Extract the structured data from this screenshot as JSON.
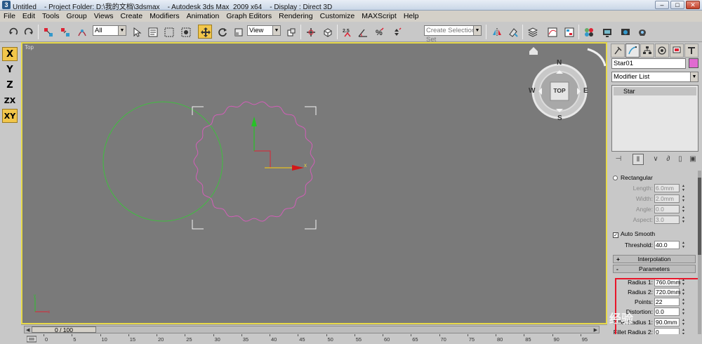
{
  "window": {
    "title": "Untitled    - Project Folder: D:\\我的文档\\3dsmax    - Autodesk 3ds Max  2009 x64    - Display : Direct 3D"
  },
  "menubar": [
    "File",
    "Edit",
    "Tools",
    "Group",
    "Views",
    "Create",
    "Modifiers",
    "Animation",
    "Graph Editors",
    "Rendering",
    "Customize",
    "MAXScript",
    "Help"
  ],
  "toolbar": {
    "selection_filter": "All",
    "reference_coord": "View",
    "named_selection_placeholder": "Create Selection Set",
    "icons": [
      "undo-icon",
      "redo-icon",
      "select-link-icon",
      "unlink-icon",
      "bind-spacewarp-icon",
      "select-object-icon",
      "select-by-name-icon",
      "rect-region-icon",
      "window-crossing-icon",
      "move-icon",
      "rotate-icon",
      "scale-icon",
      "pivot-center-icon",
      "manipulate-icon",
      "keyboard-shortcut-icon",
      "snap-3d-icon",
      "angle-snap-icon",
      "percent-snap-icon",
      "spinner-snap-icon",
      "mirror-icon",
      "align-icon",
      "layer-manager-icon",
      "curve-editor-icon",
      "schematic-view-icon",
      "material-editor-icon",
      "render-setup-icon",
      "rendered-frame-icon",
      "quick-render-icon"
    ],
    "active_tool": "move-icon"
  },
  "axis_constraints": [
    "X",
    "Y",
    "Z",
    "ZX",
    "XY"
  ],
  "axis_active": [
    "X",
    "XY"
  ],
  "viewport": {
    "label": "Top",
    "viewcube_label": "TOP",
    "compass": {
      "n": "N",
      "s": "S",
      "e": "E",
      "w": "W"
    }
  },
  "command_panel": {
    "object_name": "Star01",
    "object_color": "#e06ad0",
    "modifier_list": "Modifier List",
    "modifier_stack": [
      "Star"
    ],
    "rectangular": {
      "option_label": "Rectangular",
      "fields": [
        {
          "label": "Length:",
          "value": "6.0mm"
        },
        {
          "label": "Width:",
          "value": "2.0mm"
        },
        {
          "label": "Angle:",
          "value": "0.0"
        },
        {
          "label": "Aspect:",
          "value": "3.0"
        }
      ]
    },
    "auto_smooth": {
      "label": "Auto Smooth",
      "checked": "✓"
    },
    "threshold": {
      "label": "Threshold:",
      "value": "40.0"
    },
    "rollouts": {
      "interpolation": {
        "label": "Interpolation",
        "sign": "+"
      },
      "parameters": {
        "label": "Parameters",
        "sign": "-"
      }
    },
    "parameters": [
      {
        "label": "Radius 1:",
        "value": "760.0mm"
      },
      {
        "label": "Radius 2:",
        "value": "720.0mm"
      },
      {
        "label": "Points:",
        "value": "22"
      },
      {
        "label": "Distortion:",
        "value": "0.0"
      },
      {
        "label": "Fillet Radius 1:",
        "value": "90.0mm"
      },
      {
        "label": "Fillet Radius 2:",
        "value": "0"
      }
    ]
  },
  "timeline": {
    "frame_readout": "0 / 100",
    "ticks": [
      "0",
      "5",
      "10",
      "15",
      "20",
      "25",
      "30",
      "35",
      "40",
      "45",
      "50",
      "55",
      "60",
      "65",
      "70",
      "75",
      "80",
      "85",
      "90",
      "95"
    ]
  },
  "watermark": "经验",
  "colors": {
    "viewport_bg": "#7a7a7a",
    "active_viewport_border": "#e7d94a",
    "circle": "#3fbf3f",
    "star": "#d25fb8",
    "highlight_box": "#e8162a",
    "active_tool_bg": "#f2c64a"
  }
}
